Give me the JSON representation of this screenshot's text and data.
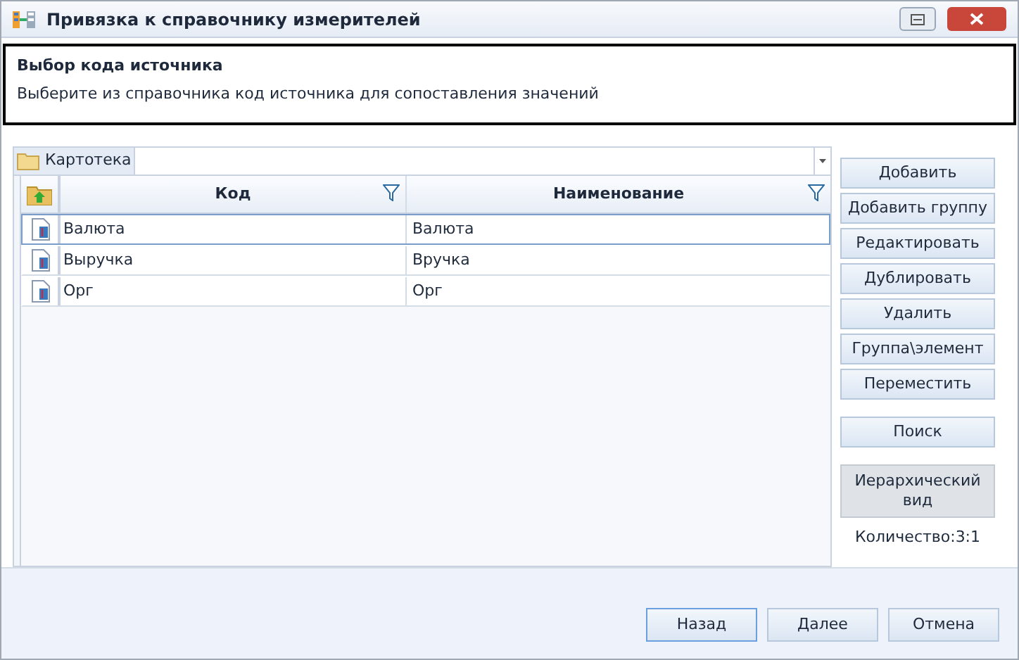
{
  "window": {
    "title": "Привязка к справочнику измерителей"
  },
  "header": {
    "title": "Выбор кода источника",
    "description": "Выберите из справочника код источника для сопоставления значений"
  },
  "breadcrumb": {
    "label": "Картотека"
  },
  "table": {
    "columns": [
      "Код",
      "Наименование"
    ],
    "rows": [
      {
        "code": "Валюта",
        "name": "Валюта",
        "selected": true
      },
      {
        "code": "Выручка",
        "name": "Вручка",
        "selected": false
      },
      {
        "code": "Орг",
        "name": "Орг",
        "selected": false
      }
    ]
  },
  "actions": [
    {
      "label": "Добавить",
      "pressed": false,
      "gap": false
    },
    {
      "label": "Добавить группу",
      "pressed": false,
      "gap": false
    },
    {
      "label": "Редактировать",
      "pressed": false,
      "gap": false
    },
    {
      "label": "Дублировать",
      "pressed": false,
      "gap": false
    },
    {
      "label": "Удалить",
      "pressed": false,
      "gap": false
    },
    {
      "label": "Группа\\элемент",
      "pressed": false,
      "gap": false
    },
    {
      "label": "Переместить",
      "pressed": false,
      "gap": false
    },
    {
      "label": "Поиск",
      "pressed": false,
      "gap": true
    },
    {
      "label": "Иерархический вид",
      "pressed": true,
      "gap": true
    }
  ],
  "count": "Количество:3:1",
  "footer_buttons": [
    {
      "label": "Назад",
      "focused": true
    },
    {
      "label": "Далее",
      "focused": false
    },
    {
      "label": "Отмена",
      "focused": false
    }
  ]
}
